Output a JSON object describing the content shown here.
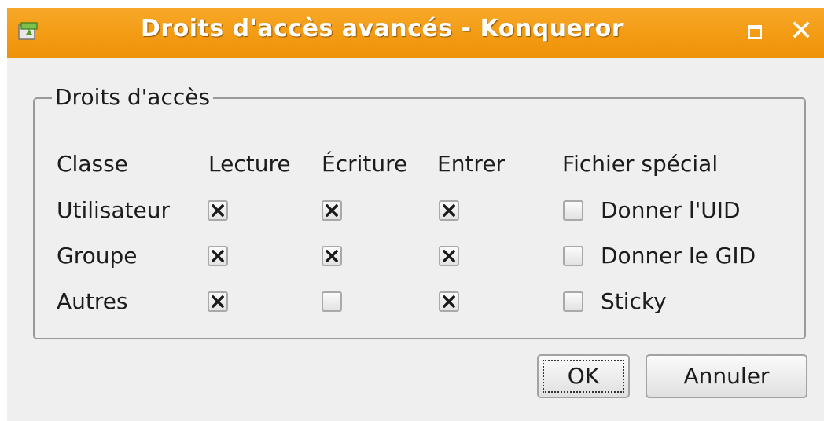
{
  "window": {
    "title": "Droits d'accès avancés - Konqueror",
    "icon": "konqueror-app-icon"
  },
  "group": {
    "legend": "Droits d'accès",
    "headers": {
      "class": "Classe",
      "read": "Lecture",
      "write": "Écriture",
      "enter": "Entrer",
      "special": "Fichier spécial"
    },
    "rows": [
      {
        "label": "Utilisateur",
        "read": true,
        "write": true,
        "enter": true,
        "special_label": "Donner l'UID",
        "special": false
      },
      {
        "label": "Groupe",
        "read": true,
        "write": true,
        "enter": true,
        "special_label": "Donner le GID",
        "special": false
      },
      {
        "label": "Autres",
        "read": true,
        "write": false,
        "enter": true,
        "special_label": "Sticky",
        "special": false
      }
    ]
  },
  "buttons": {
    "ok": "OK",
    "cancel": "Annuler"
  }
}
